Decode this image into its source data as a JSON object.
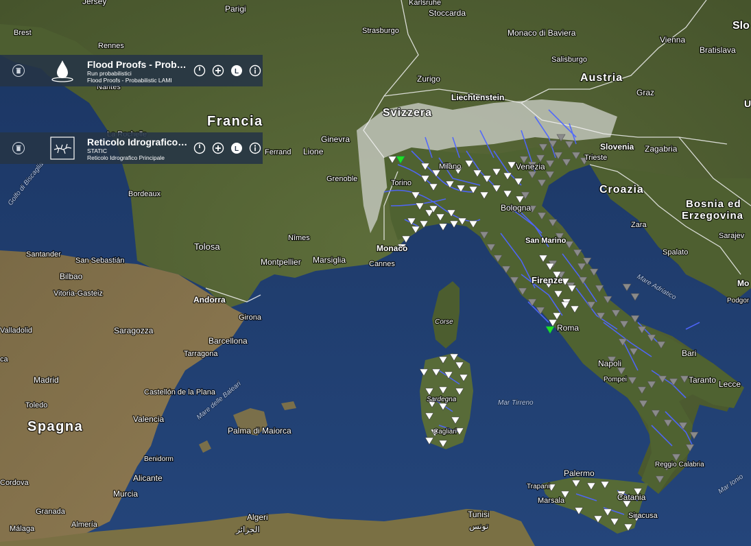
{
  "map": {
    "countries": [
      {
        "name": "Francia",
        "kind": "country"
      },
      {
        "name": "Svizzera",
        "kind": "country"
      },
      {
        "name": "Austria",
        "kind": "country"
      },
      {
        "name": "Slovenia",
        "kind": "country-small"
      },
      {
        "name": "Croazia",
        "kind": "country"
      },
      {
        "name": "Bosnia ed",
        "kind": "country"
      },
      {
        "name": "Erzegovina",
        "kind": "country"
      },
      {
        "name": "Liechtenstein",
        "kind": "country-small"
      },
      {
        "name": "Spagna",
        "kind": "country"
      },
      {
        "name": "Slo",
        "kind": "country"
      }
    ],
    "cities": [
      "Jersey",
      "Parigi",
      "Karlsruhe",
      "Stoccarda",
      "Brest",
      "Rennes",
      "Strasburgo",
      "Monaco di Baviera",
      "Vienna",
      "Bratislava",
      "Salisburgo",
      "Zurigo",
      "Nantes",
      "La Rochelle",
      "Ginevra",
      "Graz",
      "Lione",
      "Ferrand",
      "Zagabria",
      "Grenoble",
      "Torino",
      "Milano",
      "Venezia",
      "Trieste",
      "Bordeaux",
      "Bologna",
      "Zara",
      "Tolosa",
      "Nîmes",
      "Monaco",
      "San Marino",
      "Santander",
      "San Sebastián",
      "Bilbao",
      "Montpellier",
      "Marsiglia",
      "Cannes",
      "Spalato",
      "Sarajev",
      "Vitoria-Gasteiz",
      "Andorra",
      "Firenze",
      "Valladolid",
      "Girona",
      "Saragozza",
      "Corse",
      "Roma",
      "Barcellona",
      "Tarragona",
      "Bari",
      "Napoli",
      "Pompei",
      "Taranto",
      "Lecce",
      "Madrid",
      "Toledo",
      "Castellón de la Plana",
      "Sardegna",
      "Valencia",
      "Palma di Maiorca",
      "Benidorm",
      "Alicante",
      "Cordova",
      "Murcia",
      "Palermo",
      "Trapani",
      "Marsala",
      "Reggio Calabria",
      "Catania",
      "Siracusa",
      "Granada",
      "Algeri",
      "الجزائر",
      "Tunisi",
      "تونس",
      "Málaga",
      "Almería",
      "Podgor",
      "Mo",
      "U",
      "Cagliari",
      "ca"
    ],
    "seas": [
      "Golfo di Biscaglia",
      "Mare delle Baleari",
      "Mar Tirreno",
      "Mare Adriatico",
      "Mar Ionio"
    ],
    "colors": {
      "sea": "#1f3f6e",
      "land": "#59683a",
      "alps": "#d9d9d4",
      "river": "#4f66ff",
      "station_white": "#ffffff",
      "station_gray": "#8a8a8a",
      "station_green": "#21e021"
    }
  },
  "layers": [
    {
      "title": "Flood Proofs - Probabilistic LAMI",
      "subtitle": "Run probabilistici",
      "detail": "Flood Proofs - Probabilistic LAMI",
      "thumb_icon": "water-drop-icon",
      "controls": {
        "opacity": "power-icon",
        "zoom": "zoom-in-icon",
        "legend": "L",
        "info": "info-icon"
      }
    },
    {
      "title": "Reticolo Idrografico Principale",
      "subtitle": "STATIC",
      "detail": "Reticolo Idrografico Principale",
      "thumb_icon": "river-network-icon",
      "controls": {
        "opacity": "power-icon",
        "zoom": "zoom-in-icon",
        "legend": "L",
        "info": "info-icon"
      }
    }
  ]
}
